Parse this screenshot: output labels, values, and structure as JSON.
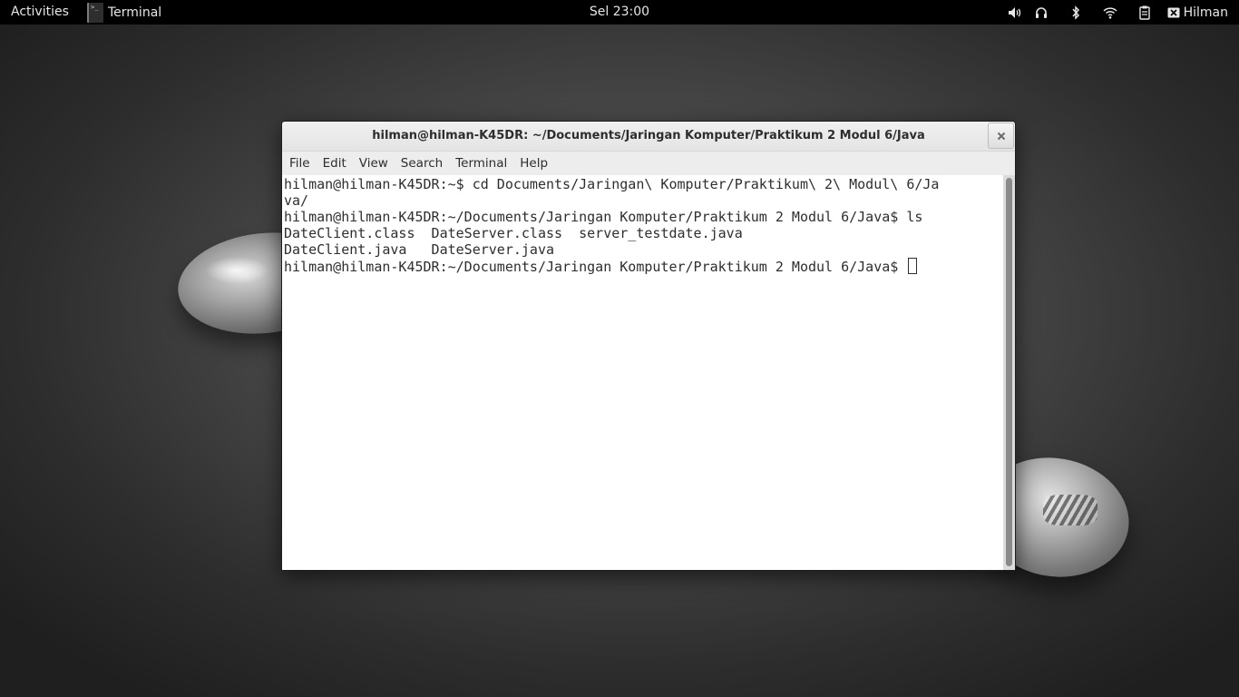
{
  "topbar": {
    "activities": "Activities",
    "app_icon": "terminal-icon",
    "app_name": "Terminal",
    "clock": "Sel 23:00",
    "tray_icons": [
      "volume-icon",
      "headphones-icon",
      "bluetooth-icon",
      "wifi-icon",
      "clipboard-icon"
    ],
    "user_icon": "user-icon",
    "user_name": "Hilman"
  },
  "window": {
    "title": "hilman@hilman-K45DR: ~/Documents/Jaringan Komputer/Praktikum 2 Modul 6/Java",
    "close_icon": "close-icon",
    "menu": [
      "File",
      "Edit",
      "View",
      "Search",
      "Terminal",
      "Help"
    ],
    "terminal": {
      "lines": [
        "hilman@hilman-K45DR:~$ cd Documents/Jaringan\\ Komputer/Praktikum\\ 2\\ Modul\\ 6/Ja",
        "va/",
        "hilman@hilman-K45DR:~/Documents/Jaringan Komputer/Praktikum 2 Modul 6/Java$ ls",
        "DateClient.class  DateServer.class  server_testdate.java",
        "DateClient.java   DateServer.java"
      ],
      "prompt": "hilman@hilman-K45DR:~/Documents/Jaringan Komputer/Praktikum 2 Modul 6/Java$ "
    }
  }
}
